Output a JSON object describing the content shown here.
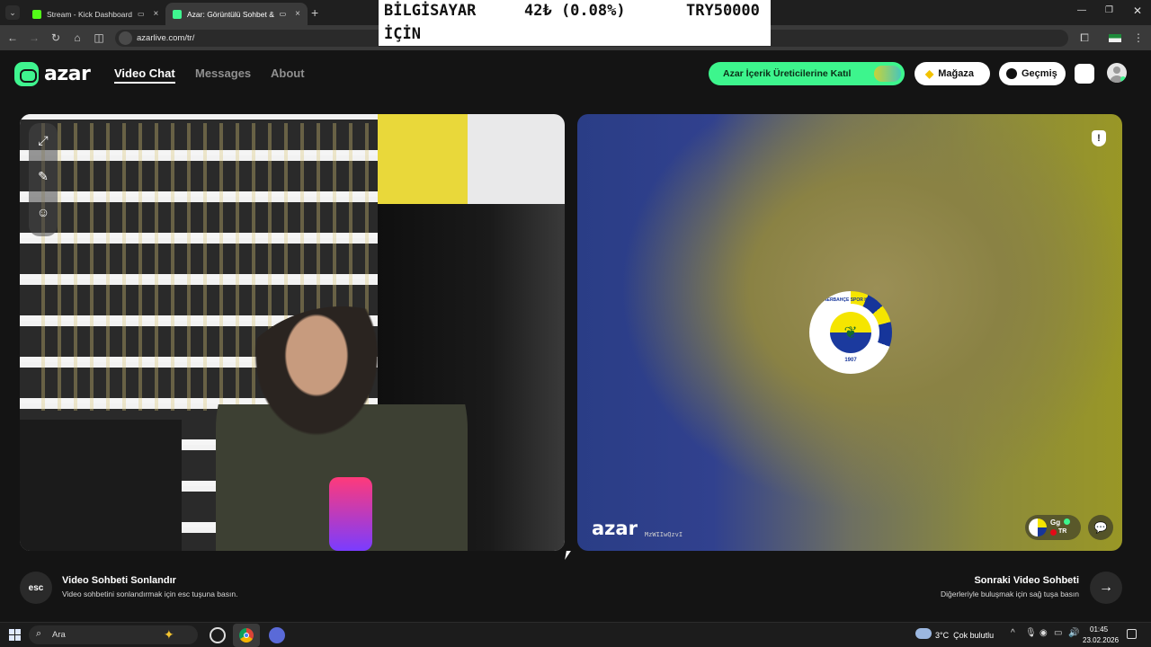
{
  "browser": {
    "tabs": [
      {
        "title": "Stream - Kick Dashboard",
        "favicon_color": "#53fc18"
      },
      {
        "title": "Azar: Görüntülü Sohbet & Y",
        "favicon_color": "#3ff58f"
      }
    ],
    "url": "azarlive.com/tr/"
  },
  "ticker": {
    "line1_left": "BİLGİSAYAR",
    "line1_mid": "42₺ (0.08%)",
    "line1_right": "TRY50000",
    "line2_left": "İÇİN"
  },
  "site": {
    "brand": "azar",
    "nav": [
      "Video Chat",
      "Messages",
      "About"
    ],
    "cta": "Azar İçerik Üreticilerine Katıl",
    "store": "Mağaza",
    "history": "Geçmiş",
    "accent": "#3df58d"
  },
  "partner": {
    "watermark": "azar",
    "watermark_id": "MzWIIwQzvI",
    "name": "Gg",
    "country": "TR",
    "emblem_ring": "FENERBAHÇE SPOR KULÜBÜ",
    "emblem_year": "1907"
  },
  "controls": {
    "end": {
      "key": "esc",
      "title": "Video Sohbeti Sonlandır",
      "hint": "Video sohbetini sonlandırmak için esc tuşuna basın."
    },
    "next": {
      "title": "Sonraki Video Sohbeti",
      "hint": "Diğerleriyle buluşmak için sağ tuşa basın"
    }
  },
  "taskbar": {
    "search": "Ara",
    "weather": "3°C  Çok bulutlu",
    "time": "01:45",
    "date": "23.02.2026"
  }
}
